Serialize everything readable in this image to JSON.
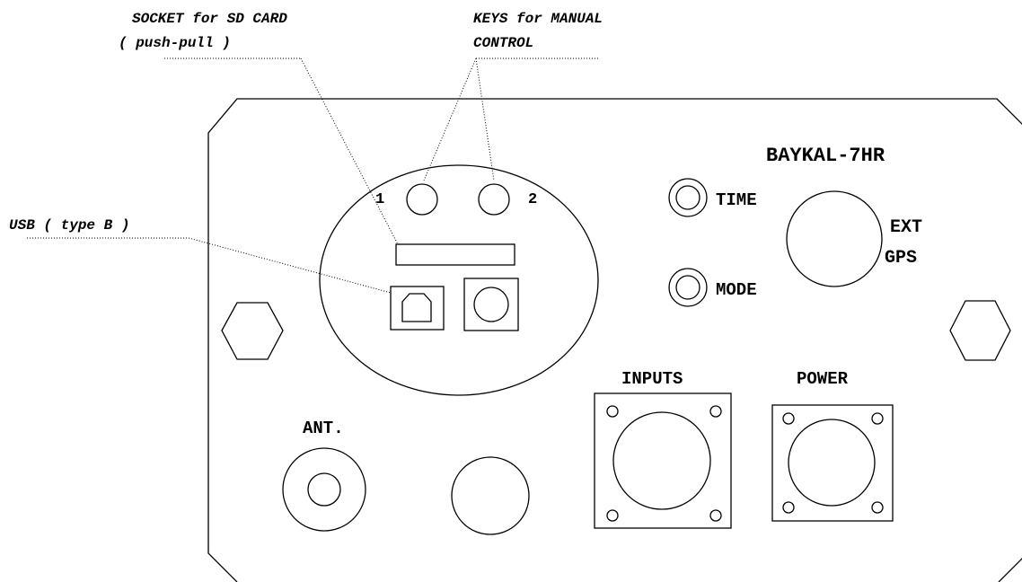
{
  "callouts": {
    "sd_socket_line1": "SOCKET for SD CARD",
    "sd_socket_line2": "( push-pull )",
    "keys_line1": "KEYS for MANUAL",
    "keys_line2": "CONTROL",
    "usb": "USB ( type B )"
  },
  "panel": {
    "model": "BAYKAL-7HR",
    "key1": "1",
    "key2": "2",
    "time_button": "TIME",
    "mode_button": "MODE",
    "ext_line1": "EXT",
    "ext_line2": "GPS",
    "inputs": "INPUTS",
    "power": "POWER",
    "antenna": "ANT."
  }
}
